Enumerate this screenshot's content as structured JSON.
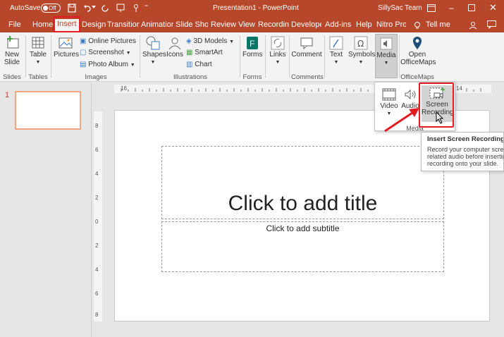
{
  "titlebar": {
    "autosave_label": "AutoSave",
    "autosave_state": "Off",
    "doc_title": "Presentation1 - PowerPoint",
    "user": "SillySac Team"
  },
  "tabs": [
    "File",
    "Home",
    "Insert",
    "Design",
    "Transition",
    "Animation",
    "Slide Sho",
    "Review",
    "View",
    "Recording",
    "Develope",
    "Add-ins",
    "Help",
    "Nitro Pro"
  ],
  "tell_me": "Tell me",
  "ribbon": {
    "slides": {
      "new_slide": "New",
      "new_slide2": "Slide",
      "group": "Slides"
    },
    "tables": {
      "table": "Table",
      "group": "Tables"
    },
    "images": {
      "pictures": "Pictures",
      "online_pictures": "Online Pictures",
      "screenshot": "Screenshot",
      "photo_album": "Photo Album",
      "group": "Images"
    },
    "illustrations": {
      "shapes": "Shapes",
      "icons": "Icons",
      "models": "3D Models",
      "smartart": "SmartArt",
      "chart": "Chart",
      "group": "Illustrations"
    },
    "forms": {
      "forms": "Forms",
      "group": "Forms"
    },
    "links": {
      "links": "Links"
    },
    "comments": {
      "comment": "Comment",
      "group": "Comments"
    },
    "text": {
      "text": "Text"
    },
    "symbols": {
      "symbols": "Symbols"
    },
    "media": {
      "media": "Media"
    },
    "officemaps": {
      "open1": "Open",
      "open2": "OfficeMaps",
      "group": "OfficeMaps"
    }
  },
  "media_dropdown": {
    "video": "Video",
    "audio": "Audio",
    "screen1": "Screen",
    "screen2": "Recording",
    "group": "Media"
  },
  "tooltip": {
    "title": "Insert Screen Recording",
    "line1": "Record your computer scree",
    "line2": "related audio before insertin",
    "line3": "recording onto your slide."
  },
  "ruler": {
    "left": "16",
    "right": "14",
    "vmarks": [
      "8",
      "6",
      "4",
      "2",
      "0",
      "2",
      "4",
      "6",
      "8"
    ]
  },
  "slide_panel": {
    "slide_number": "1"
  },
  "slide": {
    "title_placeholder": "Click to add title",
    "subtitle_placeholder": "Click to add subtitle"
  },
  "colors": {
    "brand": "#b7472a",
    "highlight": "#e31b23",
    "accent_orange": "#f4a582"
  }
}
